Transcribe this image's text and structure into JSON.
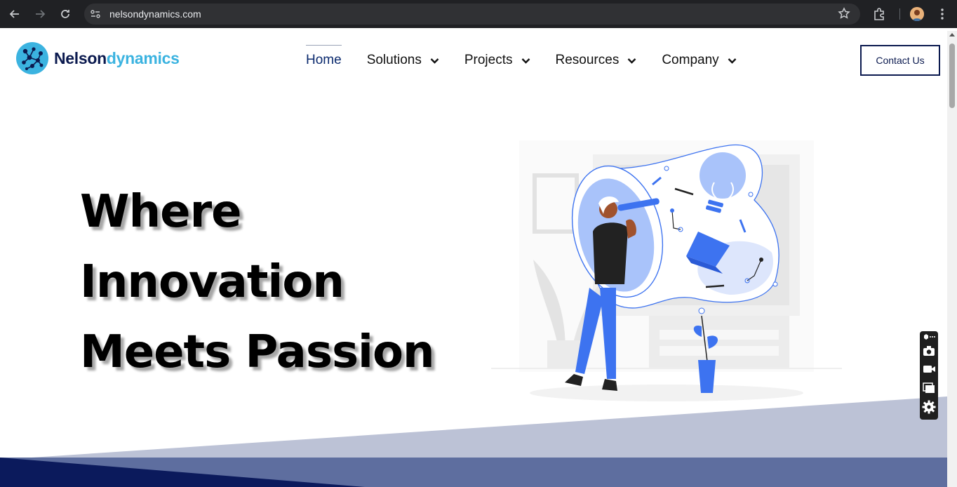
{
  "browser": {
    "url": "nelsondynamics.com"
  },
  "site": {
    "logo_part1": "Nelson",
    "logo_part2": "dynamics",
    "nav": [
      {
        "label": "Home"
      },
      {
        "label": "Solutions"
      },
      {
        "label": "Projects"
      },
      {
        "label": "Resources"
      },
      {
        "label": "Company"
      }
    ],
    "contact_label": "Contact Us"
  },
  "hero": {
    "line1": "Where",
    "line2": "Innovation",
    "line3": "Meets Passion"
  },
  "colors": {
    "brand_dark": "#0b1a4f",
    "brand_light": "#3bb3e0",
    "accent_blue": "#3d73f0",
    "wave_light": "#bcc2d6",
    "wave_mid": "#5e6e9f",
    "wave_dark": "#0b1a5c"
  }
}
